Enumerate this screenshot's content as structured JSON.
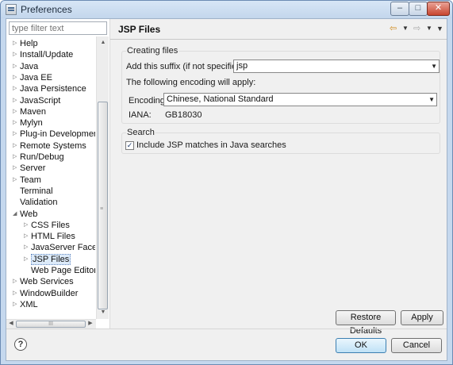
{
  "window": {
    "title": "Preferences",
    "minimize_label": "–",
    "maximize_label": "□",
    "close_label": "✕"
  },
  "filter": {
    "placeholder": "type filter text",
    "value": ""
  },
  "tree": {
    "items": [
      {
        "label": "Help",
        "expanded": false
      },
      {
        "label": "Install/Update",
        "expanded": false
      },
      {
        "label": "Java",
        "expanded": false
      },
      {
        "label": "Java EE",
        "expanded": false
      },
      {
        "label": "Java Persistence",
        "expanded": false
      },
      {
        "label": "JavaScript",
        "expanded": false
      },
      {
        "label": "Maven",
        "expanded": false
      },
      {
        "label": "Mylyn",
        "expanded": false
      },
      {
        "label": "Plug-in Development",
        "expanded": false
      },
      {
        "label": "Remote Systems",
        "expanded": false
      },
      {
        "label": "Run/Debug",
        "expanded": false
      },
      {
        "label": "Server",
        "expanded": false
      },
      {
        "label": "Team",
        "expanded": false
      },
      {
        "label": "Terminal"
      },
      {
        "label": "Validation"
      },
      {
        "label": "Web",
        "expanded": true
      },
      {
        "label": "CSS Files",
        "expanded": false
      },
      {
        "label": "HTML Files",
        "expanded": false
      },
      {
        "label": "JavaServer Faces T",
        "expanded": false
      },
      {
        "label": "JSP Files",
        "expanded": false,
        "selected": true
      },
      {
        "label": "Web Page Editor"
      },
      {
        "label": "Web Services",
        "expanded": false
      },
      {
        "label": "WindowBuilder",
        "expanded": false
      },
      {
        "label": "XML",
        "expanded": false
      }
    ],
    "vscroll_grip": "≡",
    "hscroll_grip": "III"
  },
  "page": {
    "title": "JSP Files",
    "nav": {
      "back": "⇦",
      "back_menu": "▼",
      "forward": "⇨",
      "forward_menu": "▼",
      "view_menu": "▼"
    },
    "creating_files": {
      "legend": "Creating files",
      "suffix_label": "Add this suffix (if not specified):",
      "suffix_value": "jsp",
      "encoding_note": "The following encoding will apply:",
      "encoding_label": "Encoding:",
      "encoding_value": "Chinese, National Standard",
      "iana_label": "IANA:",
      "iana_value": "GB18030"
    },
    "search": {
      "legend": "Search",
      "include_label": "Include JSP matches in Java searches",
      "include_checked": true
    },
    "restore_defaults_label": "Restore Defaults",
    "apply_label": "Apply"
  },
  "footer": {
    "help_label": "?",
    "ok_label": "OK",
    "cancel_label": "Cancel"
  }
}
